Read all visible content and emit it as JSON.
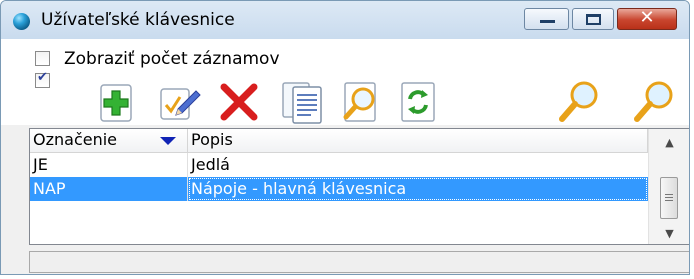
{
  "window": {
    "title": "Užívateľské klávesnice",
    "min_icon": "minimize-icon",
    "max_icon": "maximize-icon",
    "close_label": "✕"
  },
  "options": {
    "show_count_label": "Zobraziť počet záznamov",
    "show_count_checked": false,
    "second_checked": true
  },
  "toolbar": {
    "buttons": [
      {
        "icon": "add-icon"
      },
      {
        "icon": "edit-icon"
      },
      {
        "icon": "delete-icon"
      },
      {
        "icon": "copy-icon"
      },
      {
        "icon": "preview-icon"
      },
      {
        "icon": "refresh-icon"
      },
      {
        "icon": "search-icon"
      },
      {
        "icon": "search-next-icon"
      }
    ]
  },
  "grid": {
    "columns": [
      "Označenie",
      "Popis"
    ],
    "rows": [
      {
        "code": "JE",
        "desc": "Jedlá",
        "selected": false
      },
      {
        "code": "NAP",
        "desc": "Nápoje - hlavná klávesnica",
        "selected": true
      }
    ]
  },
  "colors": {
    "selection": "#3399ff",
    "close_button": "#c9452e",
    "sort_arrow": "#1023b5"
  }
}
